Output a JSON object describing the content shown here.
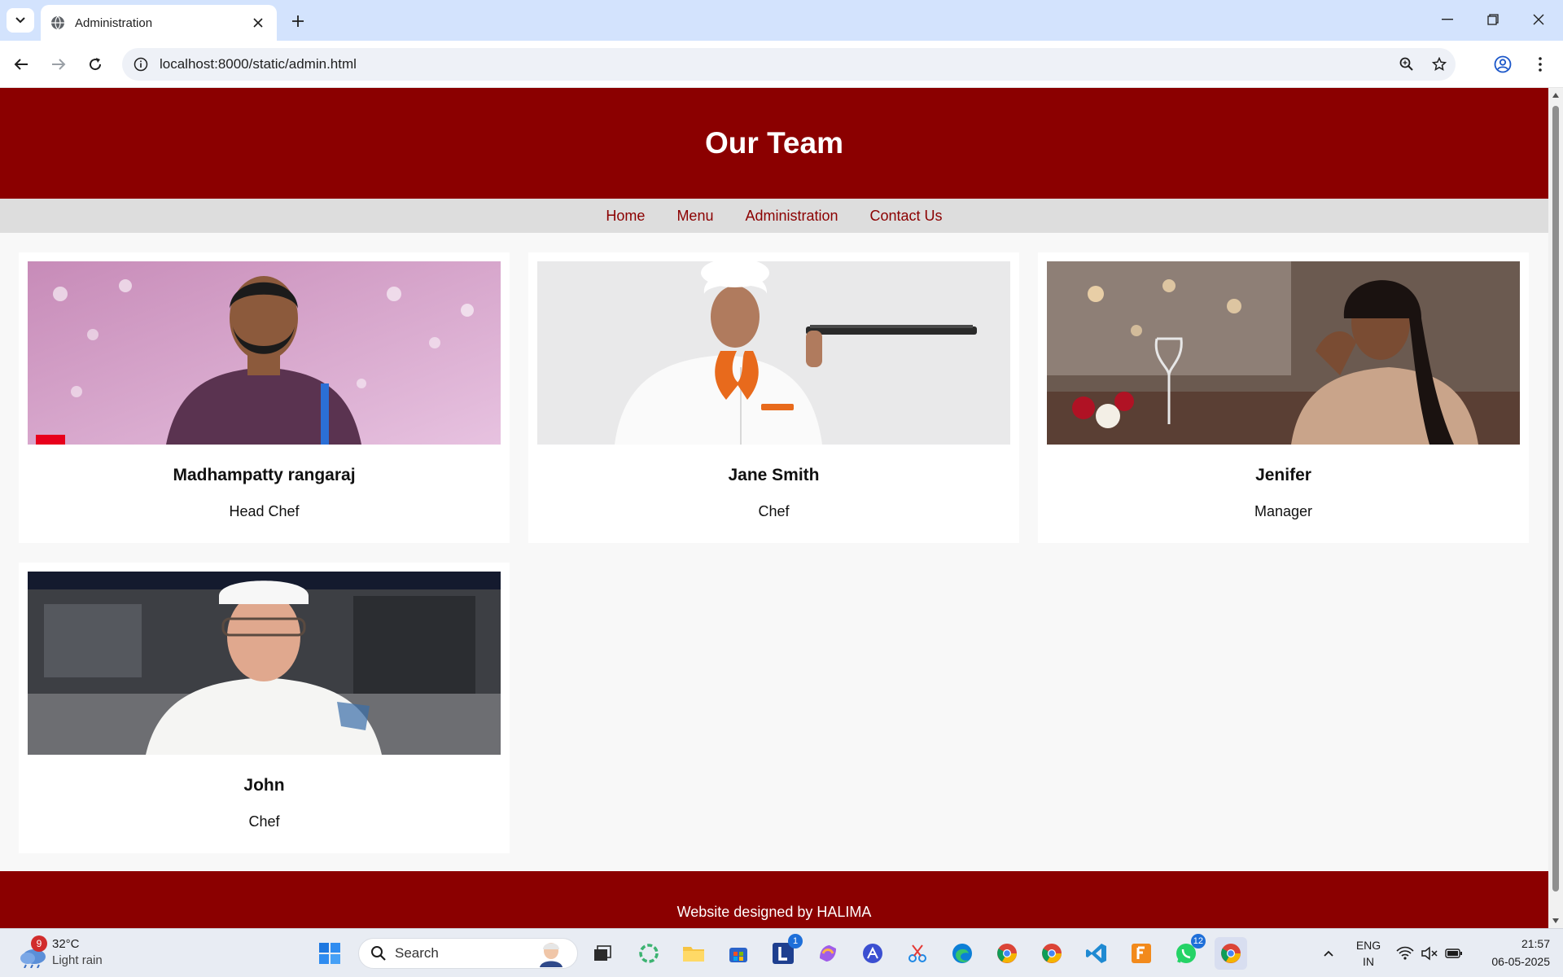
{
  "browser": {
    "tab_title": "Administration",
    "url": "localhost:8000/static/admin.html"
  },
  "page": {
    "header_title": "Our Team",
    "nav": [
      "Home",
      "Menu",
      "Administration",
      "Contact Us"
    ],
    "team": [
      {
        "name": "Madhampatty rangaraj",
        "role": "Head Chef"
      },
      {
        "name": "Jane Smith",
        "role": "Chef"
      },
      {
        "name": "Jenifer",
        "role": "Manager"
      },
      {
        "name": "John",
        "role": "Chef"
      }
    ],
    "footer_text": "Website designed by HALIMA"
  },
  "taskbar": {
    "weather_badge": "9",
    "temperature": "32°C",
    "weather_condition": "Light rain",
    "search_label": "Search",
    "outlook_badge": "1",
    "whatsapp_badge": "12",
    "language": "ENG",
    "region": "IN",
    "time": "21:57",
    "date": "06-05-2025"
  },
  "colors": {
    "brand": "#8b0000",
    "nav_bg": "#dddddd",
    "tabstrip": "#d3e3fd"
  }
}
